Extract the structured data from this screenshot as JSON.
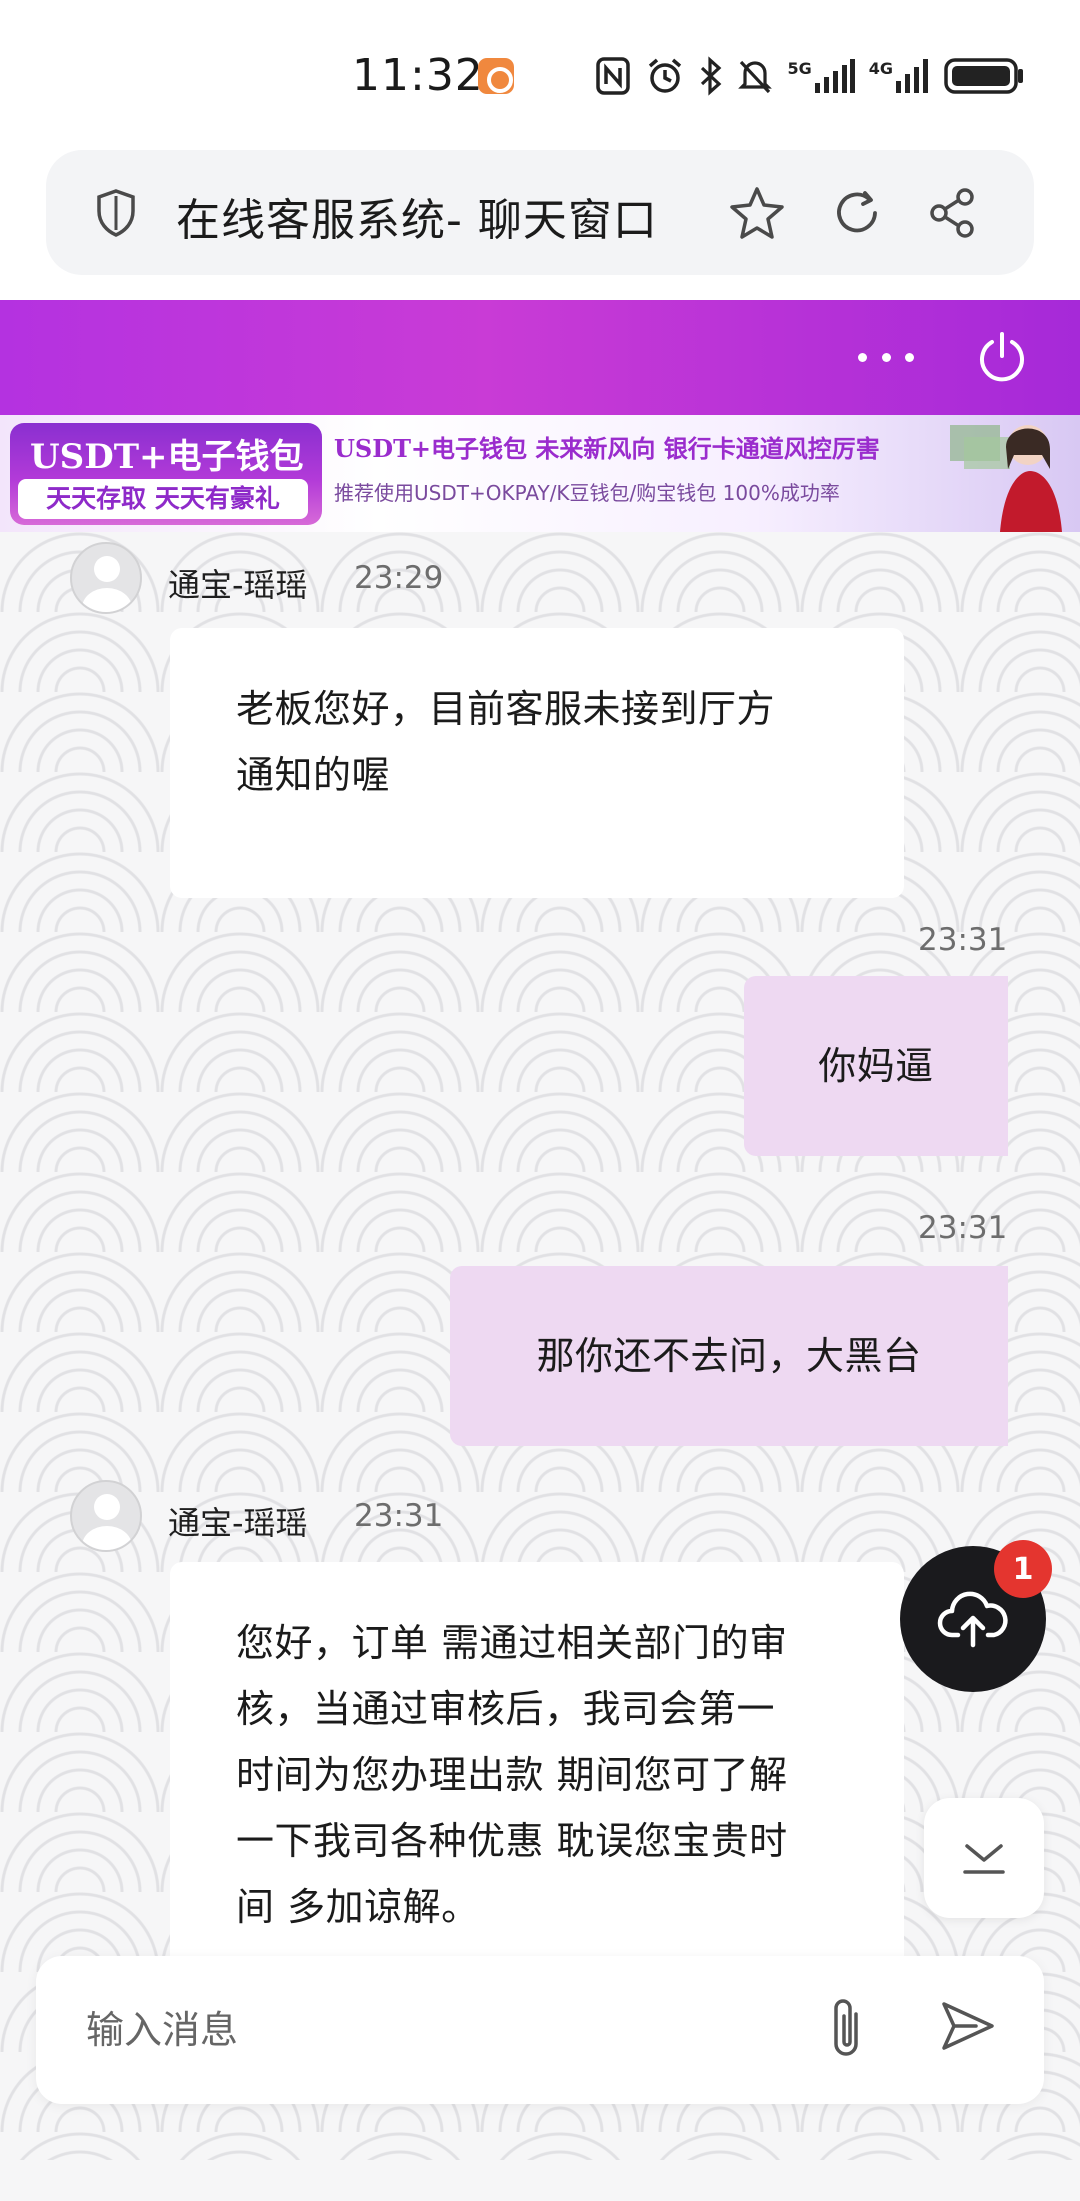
{
  "status_bar": {
    "time": "11:32",
    "network_5g": "5G",
    "network_4g": "4G"
  },
  "browser": {
    "page_title": "在线客服系统- 聊天窗口"
  },
  "banner": {
    "badge_title": "USDT+电子钱包",
    "badge_subtitle": "天天存取 天天有豪礼",
    "headline": "USDT+电子钱包  未来新风向  银行卡通道风控厉害",
    "subline": "推荐使用USDT+OKPAY/K豆钱包/购宝钱包   100%成功率"
  },
  "colors": {
    "header_purple": "#b432e0",
    "outgoing_bubble": "#eed9f2",
    "incoming_bubble": "#ffffff",
    "notification_red": "#e4352f"
  },
  "messages": [
    {
      "direction": "in",
      "sender": "通宝-瑶瑶",
      "time": "23:29",
      "lines": [
        "老板您好，目前客服未接到厅方",
        "通知的喔"
      ]
    },
    {
      "direction": "out",
      "time": "23:31",
      "text": "你妈逼"
    },
    {
      "direction": "out",
      "time": "23:31",
      "text": "那你还不去问，大黑台"
    },
    {
      "direction": "in",
      "sender": "通宝-瑶瑶",
      "time": "23:31",
      "lines": [
        "您好，订单 需通过相关部门的审",
        "核，当通过审核后，我司会第一",
        "时间为您办理出款 期间您可了解",
        "一下我司各种优惠 耽误您宝贵时",
        "间 多加谅解。"
      ]
    }
  ],
  "upload": {
    "badge_count": "1"
  },
  "composer": {
    "placeholder": "输入消息"
  },
  "icons": {
    "shield": "shield-icon",
    "star": "star-icon",
    "refresh": "refresh-icon",
    "share": "share-icon",
    "more": "more-dots-icon",
    "power": "power-icon",
    "upload": "cloud-upload-icon",
    "scroll": "chevron-down-icon",
    "attach": "paperclip-icon",
    "send": "send-icon"
  }
}
